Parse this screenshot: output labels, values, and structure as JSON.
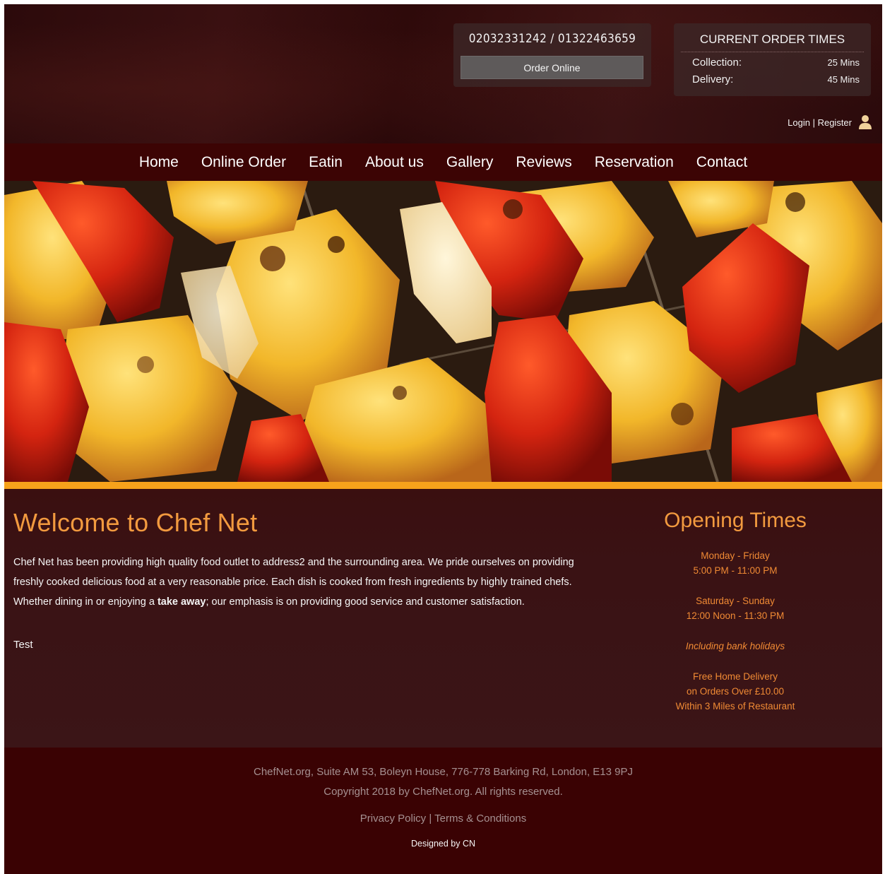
{
  "header": {
    "phones": "02032331242 / 01322463659",
    "order_online": "Order Online",
    "order_times": {
      "title": "CURRENT ORDER TIMES",
      "collection_label": "Collection:",
      "collection_value": "25 Mins",
      "delivery_label": "Delivery:",
      "delivery_value": "45 Mins"
    },
    "login": "Login",
    "separator": "|",
    "register": "Register"
  },
  "nav": {
    "items": [
      {
        "label": "Home"
      },
      {
        "label": "Online Order"
      },
      {
        "label": "Eatin"
      },
      {
        "label": "About us"
      },
      {
        "label": "Gallery"
      },
      {
        "label": "Reviews"
      },
      {
        "label": "Reservation"
      },
      {
        "label": "Contact"
      }
    ]
  },
  "main": {
    "welcome_title": "Welcome to Chef Net",
    "paragraph_start": "Chef Net has been providing high quality food outlet to address2 and the surrounding area. We pride ourselves on providing freshly cooked delicious food at a very reasonable price. Each dish is cooked from fresh ingredients by highly trained chefs. Whether dining in or enjoying a ",
    "paragraph_bold": "take away",
    "paragraph_end": "; our emphasis is on providing good service and customer satisfaction.",
    "test": "Test"
  },
  "opening": {
    "title": "Opening Times",
    "weekday_days": "Monday - Friday",
    "weekday_hours": "5:00 PM - 11:00 PM",
    "weekend_days": "Saturday - Sunday",
    "weekend_hours": "12:00 Noon - 11:30 PM",
    "holidays": "Including bank holidays",
    "delivery_1": "Free Home Delivery",
    "delivery_2": "on Orders Over £10.00",
    "delivery_3": "Within 3 Miles of Restaurant"
  },
  "footer": {
    "address": "ChefNet.org, Suite AM 53, Boleyn House, 776-778 Barking Rd, London, E13 9PJ",
    "copyright": "Copyright 2018 by ChefNet.org. All rights reserved.",
    "privacy": "Privacy Policy",
    "separator": "|",
    "terms": "Terms & Conditions",
    "designed": "Designed by CN"
  },
  "colors": {
    "header_bg": "#2c0a0b",
    "nav_bg": "#3c0404",
    "accent_orange": "#f29a3f",
    "hero_bar": "#f7a21b",
    "footer_bg": "#3a0203"
  },
  "icons": {
    "user": "user-icon"
  }
}
